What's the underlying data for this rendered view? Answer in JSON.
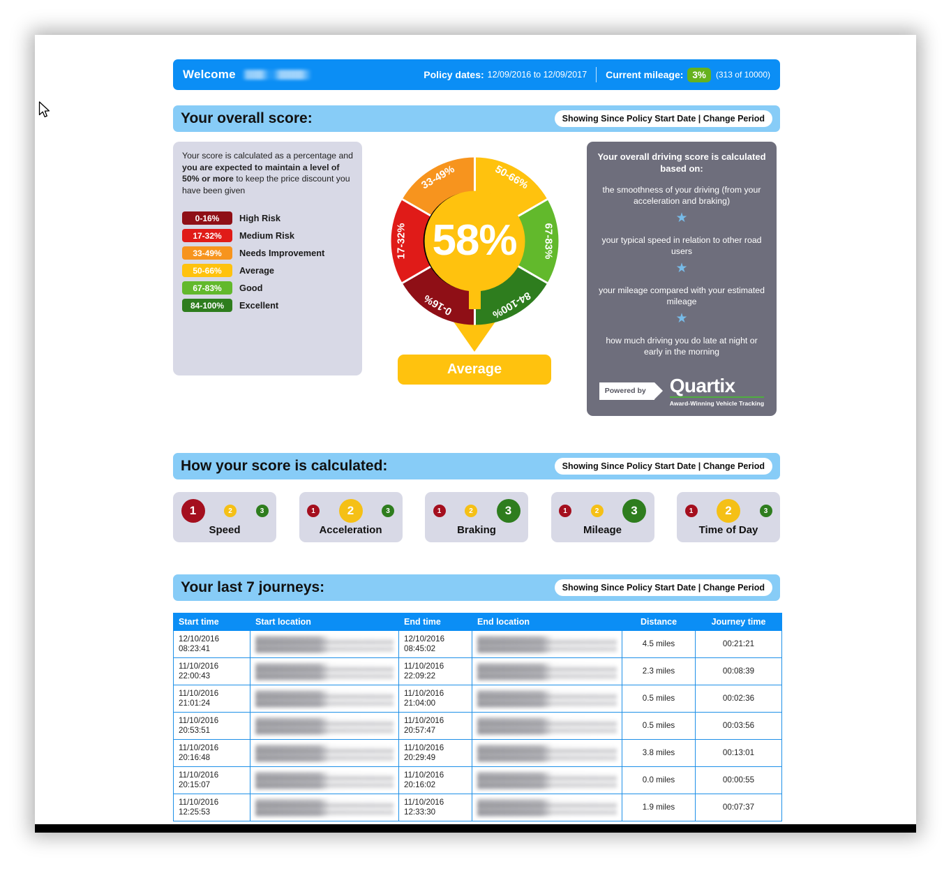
{
  "header": {
    "welcome_label": "Welcome",
    "user_name_redacted": "",
    "policy_dates_label": "Policy dates:",
    "policy_dates_value": "12/09/2016 to 12/09/2017",
    "current_mileage_label": "Current mileage:",
    "mileage_percent": "3%",
    "mileage_detail": "(313 of 10000)"
  },
  "overall": {
    "section_title": "Your overall score:",
    "period_pill": "Showing Since Policy Start Date | Change Period",
    "explainer": "Your score is calculated as a percentage and ",
    "explainer_bold": "you are expected to maintain a level of 50% or more",
    "explainer_tail": " to keep the price discount you have been given",
    "legend": [
      {
        "range": "0-16%",
        "label": "High Risk",
        "color": "#8f0f16"
      },
      {
        "range": "17-32%",
        "label": "Medium Risk",
        "color": "#e01b18"
      },
      {
        "range": "33-49%",
        "label": "Needs Improvement",
        "color": "#f7941e"
      },
      {
        "range": "50-66%",
        "label": "Average",
        "color": "#ffc20e"
      },
      {
        "range": "67-83%",
        "label": "Good",
        "color": "#62b92c"
      },
      {
        "range": "84-100%",
        "label": "Excellent",
        "color": "#2e7d1e"
      }
    ],
    "score_value": "58%",
    "rating_label": "Average",
    "rating_color": "#ffc20e"
  },
  "chart_data": {
    "type": "pie",
    "title": "Overall driving score gauge",
    "score": 58,
    "score_label": "58%",
    "rating": "Average",
    "indicator_color": "#000000",
    "segments": [
      {
        "label": "50-66%",
        "color": "#ffc20e",
        "start_deg": 0,
        "end_deg": 60
      },
      {
        "label": "67-83%",
        "color": "#62b92c",
        "start_deg": 60,
        "end_deg": 120
      },
      {
        "label": "84-100%",
        "color": "#2e7d1e",
        "start_deg": 120,
        "end_deg": 180
      },
      {
        "label": "0-16%",
        "color": "#8f0f16",
        "start_deg": 180,
        "end_deg": 240
      },
      {
        "label": "17-32%",
        "color": "#e01b18",
        "start_deg": 240,
        "end_deg": 300
      },
      {
        "label": "33-49%",
        "color": "#f7941e",
        "start_deg": 300,
        "end_deg": 360
      }
    ]
  },
  "info_panel": {
    "title": "Your overall driving score is calculated based on:",
    "items": [
      "the smoothness of your driving (from your acceleration and braking)",
      "your typical speed in relation to other road users",
      "your mileage compared with your estimated mileage",
      "how much driving you do late at night or early in the morning"
    ],
    "star_glyph": "★",
    "star_color": "#77bbe8",
    "powered_by": "Powered by",
    "brand_name": "Quartix",
    "brand_tagline": "Award-Winning Vehicle Tracking",
    "brand_rule_color": "#4fae3f"
  },
  "calculated": {
    "section_title": "How your score is calculated:",
    "period_pill": "Showing Since Policy Start Date | Change Period",
    "dot_colors": {
      "one": "#a40f1e",
      "two": "#f5c016",
      "three": "#2e7d1e"
    },
    "factors": [
      {
        "label": "Speed",
        "score": 1,
        "dots": [
          "1",
          "2",
          "3"
        ]
      },
      {
        "label": "Acceleration",
        "score": 2,
        "dots": [
          "1",
          "2",
          "3"
        ]
      },
      {
        "label": "Braking",
        "score": 3,
        "dots": [
          "1",
          "2",
          "3"
        ]
      },
      {
        "label": "Mileage",
        "score": 3,
        "dots": [
          "1",
          "2",
          "3"
        ]
      },
      {
        "label": "Time of Day",
        "score": 2,
        "dots": [
          "1",
          "2",
          "3"
        ]
      }
    ]
  },
  "journeys": {
    "section_title": "Your last 7 journeys:",
    "period_pill": "Showing Since Policy Start Date | Change Period",
    "columns": [
      "Start time",
      "Start location",
      "End time",
      "End location",
      "Distance",
      "Journey time"
    ],
    "rows": [
      {
        "start_time": "12/10/2016 08:23:41",
        "start_location": "",
        "end_time": "12/10/2016 08:45:02",
        "end_location": "",
        "distance": "4.5 miles",
        "journey_time": "00:21:21"
      },
      {
        "start_time": "11/10/2016 22:00:43",
        "start_location": "",
        "end_time": "11/10/2016 22:09:22",
        "end_location": "",
        "distance": "2.3 miles",
        "journey_time": "00:08:39"
      },
      {
        "start_time": "11/10/2016 21:01:24",
        "start_location": "",
        "end_time": "11/10/2016 21:04:00",
        "end_location": "",
        "distance": "0.5 miles",
        "journey_time": "00:02:36"
      },
      {
        "start_time": "11/10/2016 20:53:51",
        "start_location": "",
        "end_time": "11/10/2016 20:57:47",
        "end_location": "",
        "distance": "0.5 miles",
        "journey_time": "00:03:56"
      },
      {
        "start_time": "11/10/2016 20:16:48",
        "start_location": "",
        "end_time": "11/10/2016 20:29:49",
        "end_location": "",
        "distance": "3.8 miles",
        "journey_time": "00:13:01"
      },
      {
        "start_time": "11/10/2016 20:15:07",
        "start_location": "",
        "end_time": "11/10/2016 20:16:02",
        "end_location": "",
        "distance": "0.0 miles",
        "journey_time": "00:00:55"
      },
      {
        "start_time": "11/10/2016 12:25:53",
        "start_location": "",
        "end_time": "11/10/2016 12:33:30",
        "end_location": "",
        "distance": "1.9 miles",
        "journey_time": "00:07:37"
      }
    ]
  }
}
